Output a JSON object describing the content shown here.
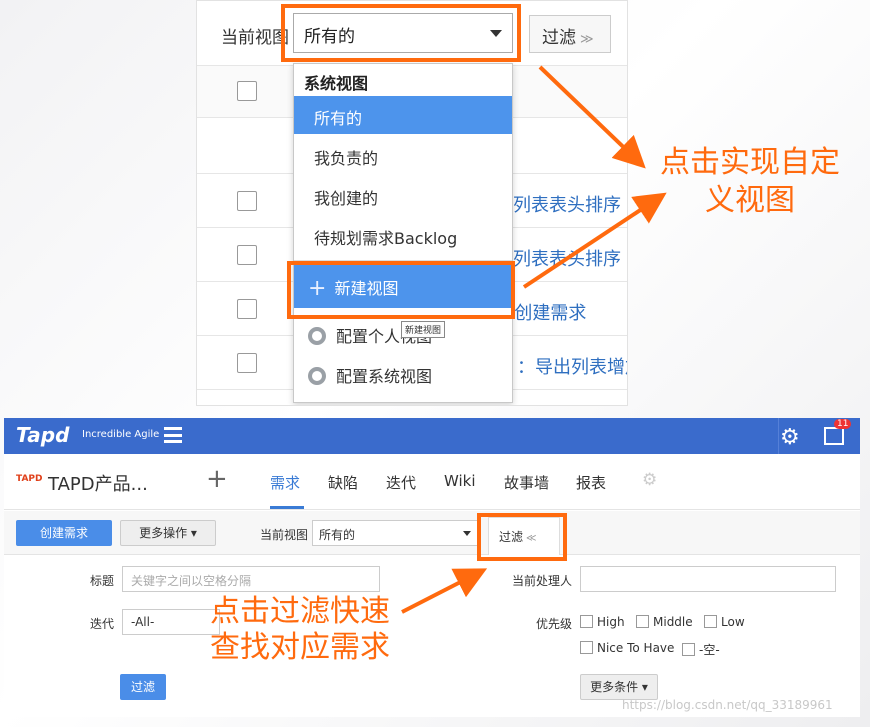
{
  "top": {
    "view_label": "当前视图",
    "view_value": "所有的",
    "filter_label": "过滤",
    "filter_chevron": "≫",
    "dropdown": {
      "group_label": "系统视图",
      "items": [
        "所有的",
        "我负责的",
        "我创建的",
        "待规划需求Backlog"
      ],
      "new_view": "新建视图",
      "new_view_icon": "plus-icon",
      "config_personal": "配置个人视图",
      "config_system": "配置系统视图",
      "config_icon": "gear-icon"
    },
    "tooltip": "新建视图",
    "rows": [
      "列表表头排序",
      "列表表头排序",
      "g创建需求",
      "：导出列表增加"
    ]
  },
  "annotations": {
    "custom_view_line1": "点击实现自定",
    "custom_view_line2": "义视图",
    "filter_line1": "点击过滤快速",
    "filter_line2": "查找对应需求",
    "color": "#ff6a0e"
  },
  "bottom": {
    "logo": "Tapd",
    "slogan": "Incredible Agile",
    "badge": "11",
    "project_logo": "TAPD",
    "project_name": "TAPD产品...",
    "add_project": "+",
    "tabs": [
      "需求",
      "缺陷",
      "迭代",
      "Wiki",
      "故事墙",
      "报表"
    ],
    "active_tab": "需求",
    "create_btn": "创建需求",
    "more_ops_btn": "更多操作 ▾",
    "view_label": "当前视图",
    "view_value": "所有的",
    "filter_btn": "过滤",
    "filter_chevron": "≪",
    "fields": {
      "title_label": "标题",
      "title_placeholder": "关键字之间以空格分隔",
      "handler_label": "当前处理人",
      "iteration_label": "迭代",
      "iteration_value": "-All-",
      "priority_label": "优先级",
      "priority_options": [
        "High",
        "Middle",
        "Low",
        "Nice To Have",
        "-空-"
      ]
    },
    "filter_go": "过滤",
    "more_conditions": "更多条件 ▾",
    "watermark": "https://blog.csdn.net/qq_33189961"
  },
  "colors": {
    "accent_blue": "#4d94ec",
    "topbar_blue": "#3a6bcc",
    "highlight_orange": "#ff6a0e"
  }
}
